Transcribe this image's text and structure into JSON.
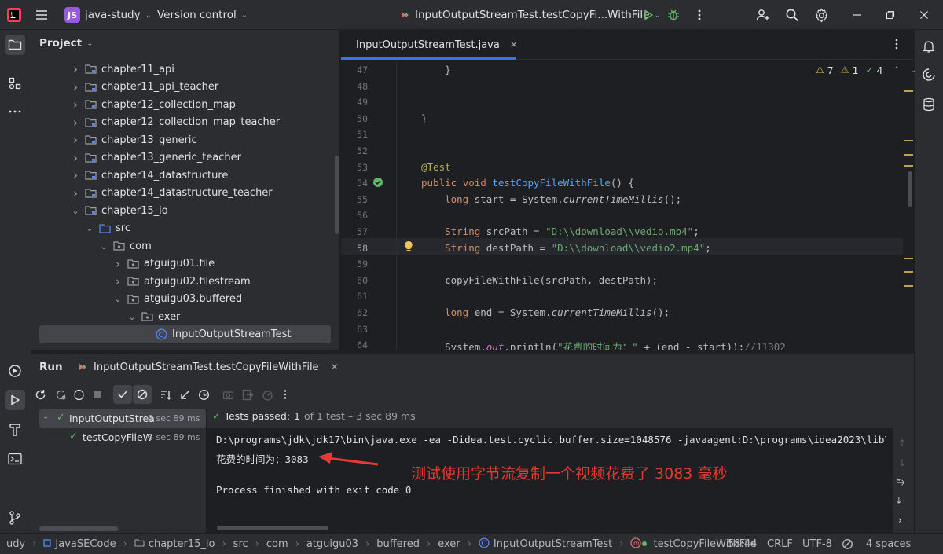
{
  "titlebar": {
    "project_badge": "JS",
    "project_name": "java-study",
    "vcs": "Version control",
    "run_config": "InputOutputStreamTest.testCopyFi...WithFile"
  },
  "project_panel": {
    "title": "Project",
    "items": [
      {
        "label": "chapter11_api",
        "type": "module"
      },
      {
        "label": "chapter11_api_teacher",
        "type": "module"
      },
      {
        "label": "chapter12_collection_map",
        "type": "module"
      },
      {
        "label": "chapter12_collection_map_teacher",
        "type": "module"
      },
      {
        "label": "chapter13_generic",
        "type": "module"
      },
      {
        "label": "chapter13_generic_teacher",
        "type": "module"
      },
      {
        "label": "chapter14_datastructure",
        "type": "module"
      },
      {
        "label": "chapter14_datastructure_teacher",
        "type": "module"
      },
      {
        "label": "chapter15_io",
        "type": "module",
        "expanded": true
      },
      {
        "label": "src",
        "type": "source",
        "expanded": true
      },
      {
        "label": "com",
        "type": "package",
        "expanded": true
      },
      {
        "label": "atguigu01.file",
        "type": "package"
      },
      {
        "label": "atguigu02.filestream",
        "type": "package"
      },
      {
        "label": "atguigu03.buffered",
        "type": "package",
        "expanded": true
      },
      {
        "label": "exer",
        "type": "package",
        "expanded": true
      },
      {
        "label": "InputOutputStreamTest",
        "type": "class",
        "selected": true
      }
    ]
  },
  "editor": {
    "tab_label": "InputOutputStreamTest.java",
    "inspections": {
      "warnings": "7",
      "weak": "1",
      "ok": "4"
    },
    "lines": [
      {
        "num": "47",
        "text": "    }"
      },
      {
        "num": "48",
        "text": ""
      },
      {
        "num": "49",
        "text": ""
      },
      {
        "num": "50",
        "text": "}"
      },
      {
        "num": "51",
        "text": ""
      },
      {
        "num": "52",
        "text": ""
      },
      {
        "num": "53",
        "text": "@Test"
      },
      {
        "num": "54",
        "text": "public void testCopyFileWithFile() {"
      },
      {
        "num": "55",
        "text": "    long start = System.currentTimeMillis();"
      },
      {
        "num": "56",
        "text": ""
      },
      {
        "num": "57",
        "text": "    String srcPath = \"D:\\\\download\\\\vedio.mp4\";"
      },
      {
        "num": "58",
        "text": "    String destPath = \"D:\\\\download\\\\vedio2.mp4\";"
      },
      {
        "num": "59",
        "text": ""
      },
      {
        "num": "60",
        "text": "    copyFileWithFile(srcPath, destPath);"
      },
      {
        "num": "61",
        "text": ""
      },
      {
        "num": "62",
        "text": "    long end = System.currentTimeMillis();"
      },
      {
        "num": "63",
        "text": ""
      },
      {
        "num": "64",
        "text": "    System.out.println(\"花费的时间为：\" + (end - start));//11302"
      }
    ]
  },
  "run_panel": {
    "title": "Run",
    "tab_label": "InputOutputStreamTest.testCopyFileWithFile",
    "tests_passed_label": "Tests passed:",
    "tests_passed_count": "1",
    "tests_passed_detail": "of 1 test – 3 sec 89 ms",
    "tree": [
      {
        "label": "InputOutputStrea",
        "time": "3 sec 89 ms"
      },
      {
        "label": "testCopyFileW",
        "time": "3 sec 89 ms"
      }
    ],
    "console": {
      "cmd": "D:\\programs\\jdk\\jdk17\\bin\\java.exe -ea -Didea.test.cyclic.buffer.size=1048576 -javaagent:D:\\programs\\idea2023\\lib\\",
      "output": "花费的时间为：3083",
      "exit": "Process finished with exit code 0",
      "annotation": "测试使用字节流复制一个视频花费了 3083 毫秒"
    }
  },
  "statusbar": {
    "crumbs": [
      "udy",
      "JavaSECode",
      "chapter15_io",
      "src",
      "com",
      "atguigu03",
      "buffered",
      "exer",
      "InputOutputStreamTest",
      "testCopyFileWithFile"
    ],
    "position": "58:44",
    "line_sep": "CRLF",
    "encoding": "UTF-8",
    "indent": "4 spaces"
  },
  "colors": {
    "accent": "#3574f0",
    "annotation_red": "#e53935",
    "passed_green": "#5fb865"
  }
}
